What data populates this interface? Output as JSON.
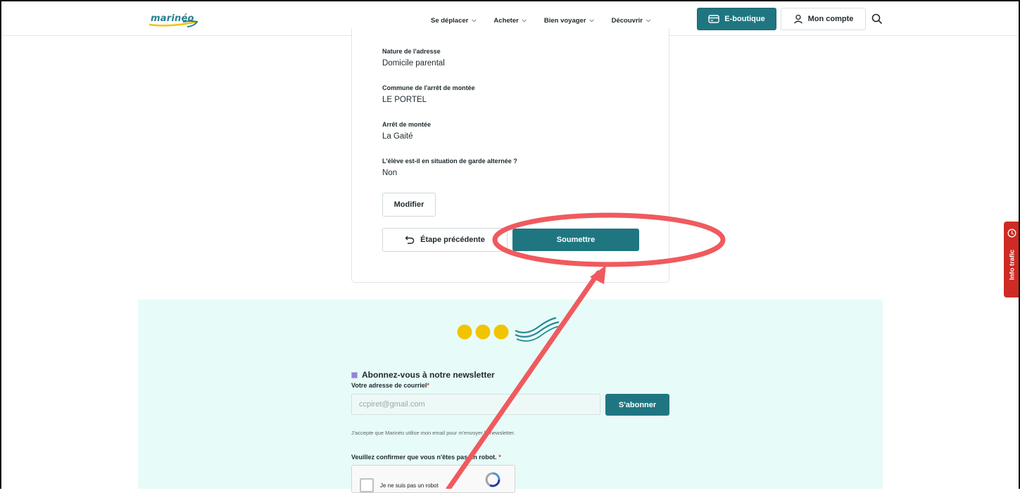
{
  "header": {
    "logo_text": "marinéo",
    "nav": [
      {
        "label": "Se déplacer"
      },
      {
        "label": "Acheter"
      },
      {
        "label": "Bien voyager"
      },
      {
        "label": "Découvrir"
      }
    ],
    "eshop_label": "E-boutique",
    "account_label": "Mon compte"
  },
  "summary": {
    "fields": [
      {
        "label": "Nature de l'adresse",
        "value": "Domicile parental"
      },
      {
        "label": "Commune de l'arrêt de montée",
        "value": "LE PORTEL"
      },
      {
        "label": "Arrêt de montée",
        "value": "La Gaité"
      },
      {
        "label": "L'élève est-il en situation de garde alternée ?",
        "value": "Non"
      }
    ],
    "modify_label": "Modifier",
    "prev_label": "Étape précédente",
    "submit_label": "Soumettre"
  },
  "newsletter": {
    "title": "Abonnez-vous à notre newsletter",
    "email_label": "Votre adresse de courriel",
    "required_mark": "*",
    "email_value": "ccpiret@gmail.com",
    "subscribe_label": "S'abonner",
    "consent": "J'accepte que Marinéo utilise mon email pour m'envoyer la newsletter.",
    "robot_question": "Veuillez confirmer que vous n'êtes pas un robot.",
    "captcha_label": "Je ne suis pas un robot"
  },
  "side_tab": {
    "label": "Info trafic"
  },
  "colors": {
    "brand_teal": "#1f7681",
    "footer_bg": "#e7fbf8",
    "annotation_red": "#f05a5e",
    "dot_yellow": "#f2c400",
    "info_red": "#d02a24"
  },
  "icons": [
    "chevron-down-icon",
    "card-icon",
    "user-icon",
    "search-icon",
    "undo-arrow-icon",
    "clock-icon",
    "recaptcha-icon"
  ]
}
